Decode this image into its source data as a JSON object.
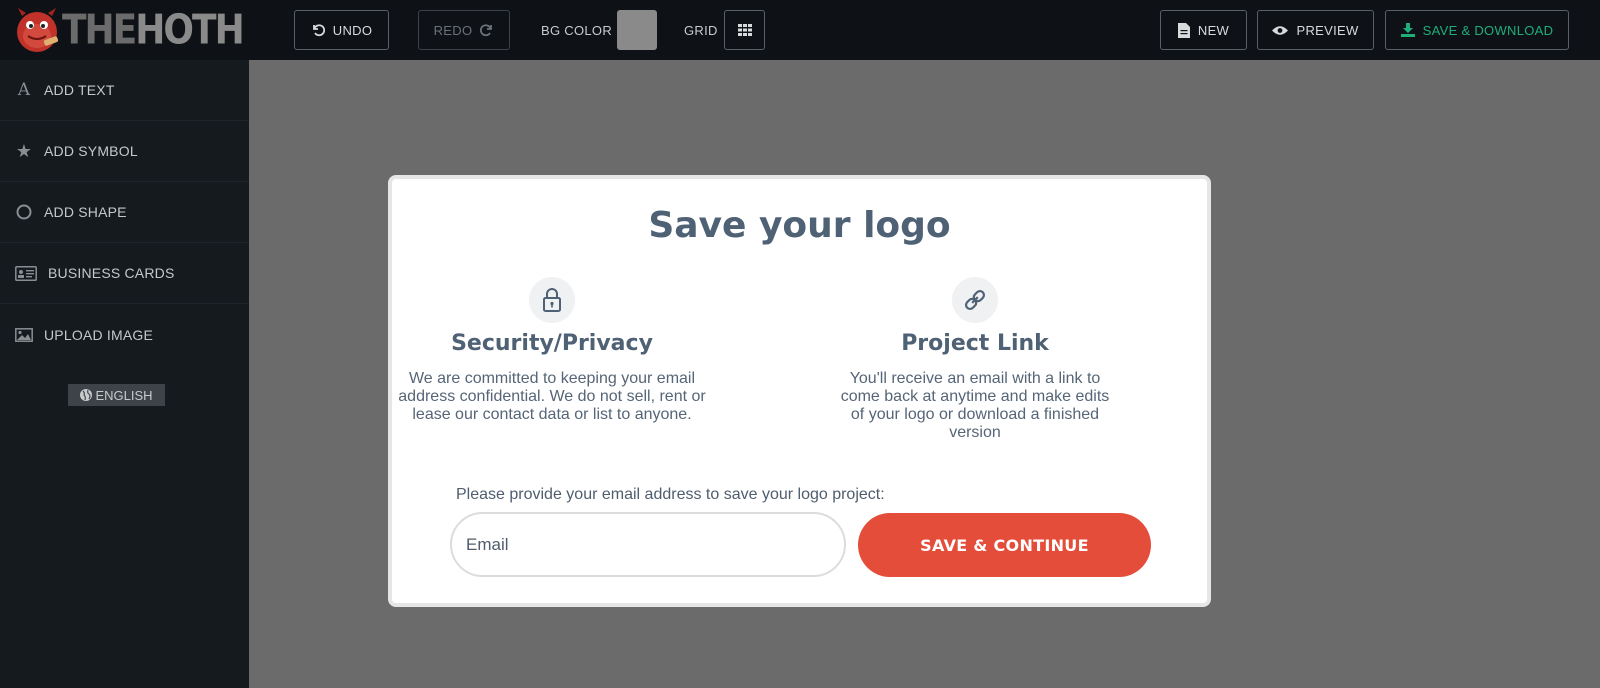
{
  "brand": {
    "part1": "THE",
    "part2": "HOTH"
  },
  "toolbar": {
    "undo": "UNDO",
    "redo": "REDO",
    "bg_color_label": "BG COLOR",
    "grid_label": "GRID",
    "new": "NEW",
    "preview": "PREVIEW",
    "save_download": "SAVE & DOWNLOAD",
    "bg_color_value": "#8a8a8a"
  },
  "sidebar": {
    "items": [
      {
        "label": "ADD TEXT",
        "icon": "letter-a-icon"
      },
      {
        "label": "ADD SYMBOL",
        "icon": "star-icon"
      },
      {
        "label": "ADD SHAPE",
        "icon": "circle-icon"
      },
      {
        "label": "BUSINESS CARDS",
        "icon": "id-card-icon"
      },
      {
        "label": "UPLOAD IMAGE",
        "icon": "image-icon"
      }
    ],
    "language": "ENGLISH"
  },
  "modal": {
    "title": "Save your logo",
    "security": {
      "title": "Security/Privacy",
      "text": "We are committed to keeping your email address confidential. We do not sell, rent or lease our contact data or list to anyone."
    },
    "project": {
      "title": "Project Link",
      "text": "You'll receive an email with a link to come back at anytime and make edits of your logo or download a finished version"
    },
    "prompt": "Please provide your email address to save your logo project:",
    "email_placeholder": "Email",
    "email_value": "",
    "button": "SAVE & CONTINUE"
  },
  "colors": {
    "accent_green": "#1fae7a",
    "button_red": "#e44d3a",
    "heading": "#4f6174",
    "canvas_bg": "#6b6b6b"
  }
}
